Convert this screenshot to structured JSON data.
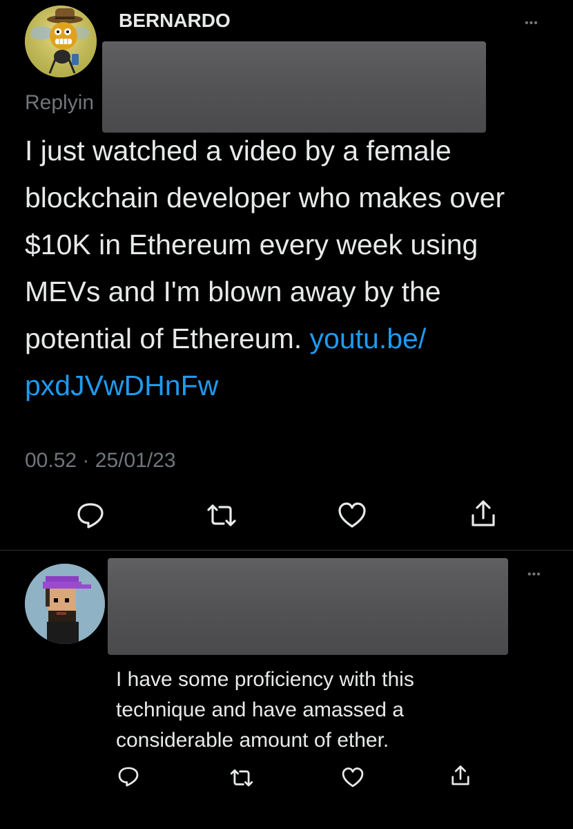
{
  "tweet": {
    "author_name": "BERNARDO",
    "replying_prefix": "Replyin",
    "text": "I just watched a video by a female blockchain developer who makes over $10K in Ethereum every week using MEVs and I'm blown away by the potential of Ethereum.",
    "link_line1": "youtu.be/",
    "link_line2": "pxdJVwDHnFw",
    "time": "00.52",
    "separator": "·",
    "date": "25/01/23",
    "more": "•••",
    "actions": [
      "reply-icon",
      "retweet-icon",
      "like-icon",
      "share-icon"
    ]
  },
  "reply": {
    "more": "•••",
    "text_line1": "I have some proficiency with this",
    "text_line2": "technique and have amassed a",
    "text_line3": "considerable amount of ether.",
    "actions": [
      "reply-icon",
      "retweet-icon",
      "like-icon",
      "share-icon"
    ]
  },
  "colors": {
    "background": "#000000",
    "text": "#e7e9ea",
    "muted": "#71767b",
    "link": "#1d9bf0",
    "redaction": "#555557"
  }
}
